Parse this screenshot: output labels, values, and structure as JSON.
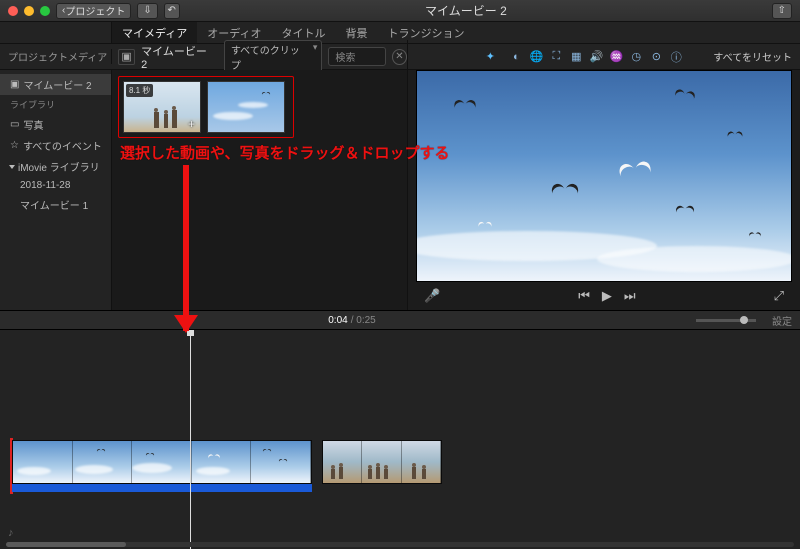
{
  "title": "マイムービー 2",
  "titlebar": {
    "back": "プロジェクト",
    "share_icon": "share"
  },
  "traffic": {
    "close": "#ff5f57",
    "min": "#febc2e",
    "max": "#28c840"
  },
  "tabs": {
    "items": [
      "マイメディア",
      "オーディオ",
      "タイトル",
      "背景",
      "トランジション"
    ],
    "active": 0
  },
  "sidebar": {
    "header": "プロジェクトメディア",
    "project_item": "マイムービー 2",
    "lib_header": "ライブラリ",
    "photos": "写真",
    "all_events": "すべてのイベント",
    "imovie_lib": "iMovie ライブラリ",
    "date": "2018-11-28",
    "movie1": "マイムービー 1"
  },
  "crumb": {
    "label": "マイムービー 2"
  },
  "browser": {
    "filter": "すべてのクリップ",
    "search_placeholder": "検索",
    "clip1_badge": "8.1 秒"
  },
  "toolbar": {
    "reset": "すべてをリセット"
  },
  "ruler": {
    "current": "0:04",
    "duration": "0:25",
    "settings": "設定"
  },
  "annotation": "選択した動画や、写真をドラッグ＆ドロップする"
}
